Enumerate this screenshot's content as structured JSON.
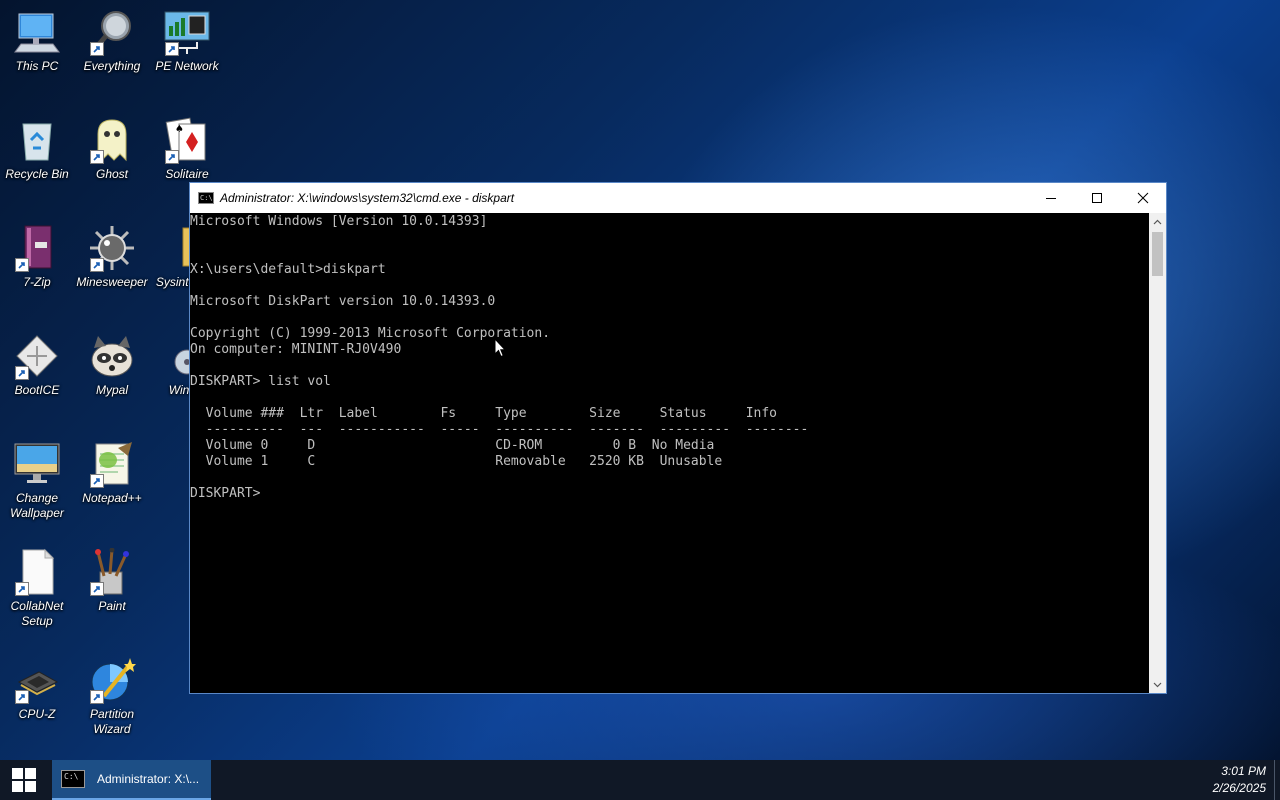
{
  "desktop_icons": [
    {
      "id": "this-pc",
      "label": "This PC"
    },
    {
      "id": "everything",
      "label": "Everything"
    },
    {
      "id": "pe-network",
      "label": "PE Network"
    },
    {
      "id": "recycle-bin",
      "label": "Recycle Bin"
    },
    {
      "id": "ghost",
      "label": "Ghost"
    },
    {
      "id": "solitaire",
      "label": "Solitaire"
    },
    {
      "id": "7-zip",
      "label": "7-Zip"
    },
    {
      "id": "minesweeper",
      "label": "Minesweeper"
    },
    {
      "id": "sysinternals",
      "label": "Sysinte Too"
    },
    {
      "id": "booticE",
      "label": "BootICE"
    },
    {
      "id": "mypal",
      "label": "Mypal"
    },
    {
      "id": "winnt",
      "label": "WinNT"
    },
    {
      "id": "change-wallpaper",
      "label": "Change Wallpaper"
    },
    {
      "id": "notepad-plus-plus",
      "label": "Notepad++"
    },
    {
      "id": "collabnet-setup",
      "label": "CollabNet Setup"
    },
    {
      "id": "paint",
      "label": "Paint"
    },
    {
      "id": "cpu-z",
      "label": "CPU-Z"
    },
    {
      "id": "partition-wizard",
      "label": "Partition Wizard"
    }
  ],
  "cmd_window": {
    "title": "Administrator: X:\\windows\\system32\\cmd.exe - diskpart",
    "icon_text": "C:\\",
    "lines": [
      "Microsoft Windows [Version 10.0.14393]",
      "",
      "",
      "X:\\users\\default>diskpart",
      "",
      "Microsoft DiskPart version 10.0.14393.0",
      "",
      "Copyright (C) 1999-2013 Microsoft Corporation.",
      "On computer: MININT-RJ0V490",
      "",
      "DISKPART> list vol",
      "",
      "  Volume ###  Ltr  Label        Fs     Type        Size     Status     Info",
      "  ----------  ---  -----------  -----  ----------  -------  ---------  --------",
      "  Volume 0     D                       CD-ROM         0 B  No Media",
      "  Volume 1     C                       Removable   2520 KB  Unusable",
      "",
      "DISKPART> "
    ]
  },
  "taskbar": {
    "task_label": "Administrator: X:\\...",
    "clock_time": "3:01 PM",
    "clock_date": "2/26/2025"
  },
  "colors": {
    "console_bg": "#000000",
    "console_fg": "#c0c0c0",
    "taskbar_bg": "#101826",
    "taskbar_active": "#1d4f86"
  }
}
